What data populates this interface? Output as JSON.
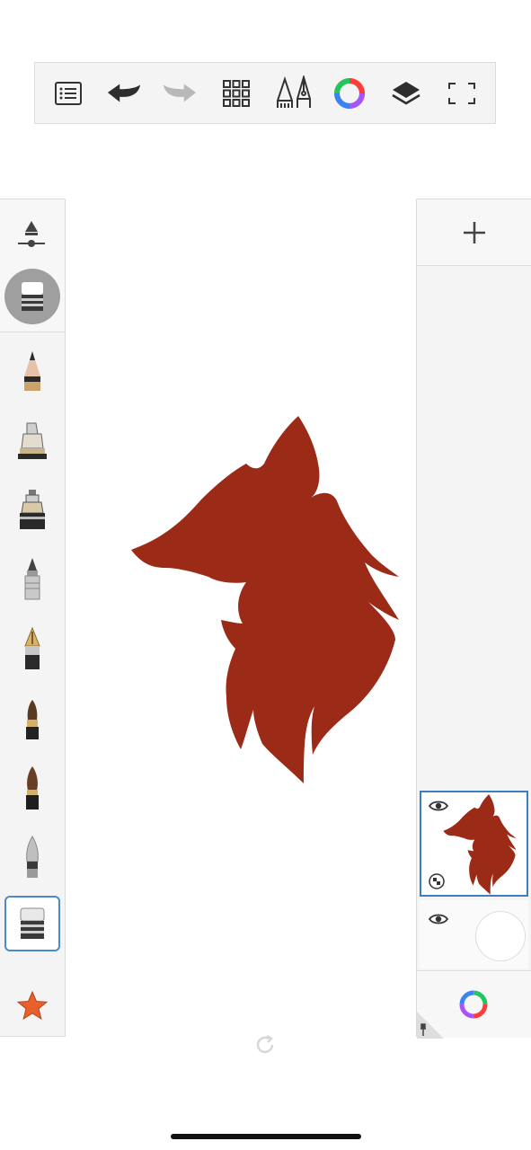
{
  "toolbar": {
    "buttons": [
      {
        "name": "list-menu-icon",
        "interactable": true
      },
      {
        "name": "undo-icon",
        "interactable": true
      },
      {
        "name": "redo-icon",
        "interactable": true,
        "state": "disabled"
      },
      {
        "name": "grid-icon",
        "interactable": true
      },
      {
        "name": "brush-library-icon",
        "interactable": true
      },
      {
        "name": "color-wheel-icon",
        "interactable": true
      },
      {
        "name": "layers-icon",
        "interactable": true
      },
      {
        "name": "fullscreen-icon",
        "interactable": true
      }
    ]
  },
  "brush_panel": {
    "tools": [
      "brush-size-slider-icon",
      "eraser-preview-icon",
      "pencil-icon",
      "marker-icon",
      "airbrush-icon",
      "ballpoint-pen-icon",
      "fountain-pen-icon",
      "paintbrush-icon",
      "ink-brush-icon",
      "smudge-icon",
      "eraser-icon",
      "favorites-star-icon"
    ],
    "selected_tool": "eraser-icon"
  },
  "canvas": {
    "artwork": "fox-head-illustration",
    "colors": {
      "fox": "#9b2a16",
      "background": "#ffffff"
    }
  },
  "layers_panel": {
    "add_icon": "plus-icon",
    "layers": [
      {
        "name": "layer-fox",
        "visible": true,
        "selected": true
      },
      {
        "name": "layer-background",
        "visible": true,
        "selected": false
      }
    ],
    "bottom_icons": [
      "color-wheel-icon",
      "pin-icon"
    ]
  },
  "colors": {
    "accent": "#3d7dc4",
    "panel": "#f4f4f4",
    "star": "#e8602c"
  }
}
